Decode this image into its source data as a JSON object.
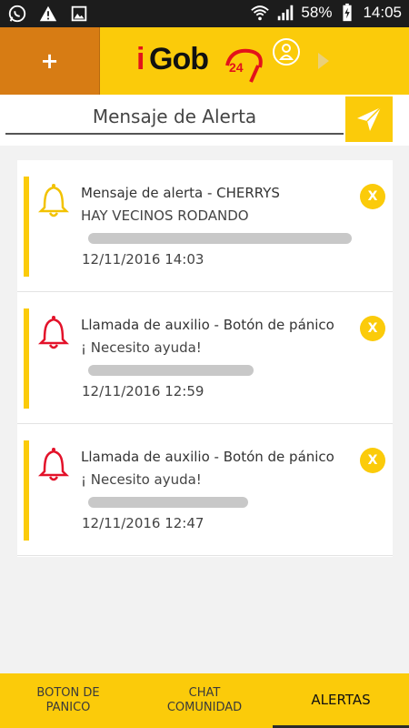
{
  "status_bar": {
    "battery": "58%",
    "time": "14:05",
    "left_icons": [
      "whatsapp-icon",
      "warning-icon",
      "image-icon"
    ],
    "right_icons": [
      "wifi-icon",
      "signal-icon",
      "battery-charging-icon"
    ]
  },
  "app": {
    "add_label": "+",
    "logo_i": "i",
    "logo_gob": "Gob",
    "logo_24": "24"
  },
  "alert_input": {
    "placeholder": "Mensaje de Alerta",
    "value": ""
  },
  "alerts": [
    {
      "title": "Mensaje de alerta - CHERRYS",
      "message": "HAY VECINOS RODANDO",
      "date": "12/11/2016 14:03",
      "bell_color": "#f2c200",
      "close_label": "X"
    },
    {
      "title": "Llamada de auxilio - Botón de pánico",
      "message": "¡ Necesito ayuda!",
      "date": "12/11/2016 12:59",
      "bell_color": "#e3122a",
      "close_label": "X"
    },
    {
      "title": "Llamada de auxilio - Botón de pánico",
      "message": "¡ Necesito ayuda!",
      "date": "12/11/2016 12:47",
      "bell_color": "#e3122a",
      "close_label": "X"
    }
  ],
  "tabs": [
    {
      "label_line1": "BOTON DE",
      "label_line2": "PANICO"
    },
    {
      "label_line1": "CHAT",
      "label_line2": "COMUNIDAD"
    },
    {
      "label_line1": "ALERTAS",
      "label_line2": ""
    }
  ],
  "colors": {
    "primary": "#fbcb0a",
    "accent_orange": "#d77c14",
    "status_bar": "#1c1c1c"
  }
}
